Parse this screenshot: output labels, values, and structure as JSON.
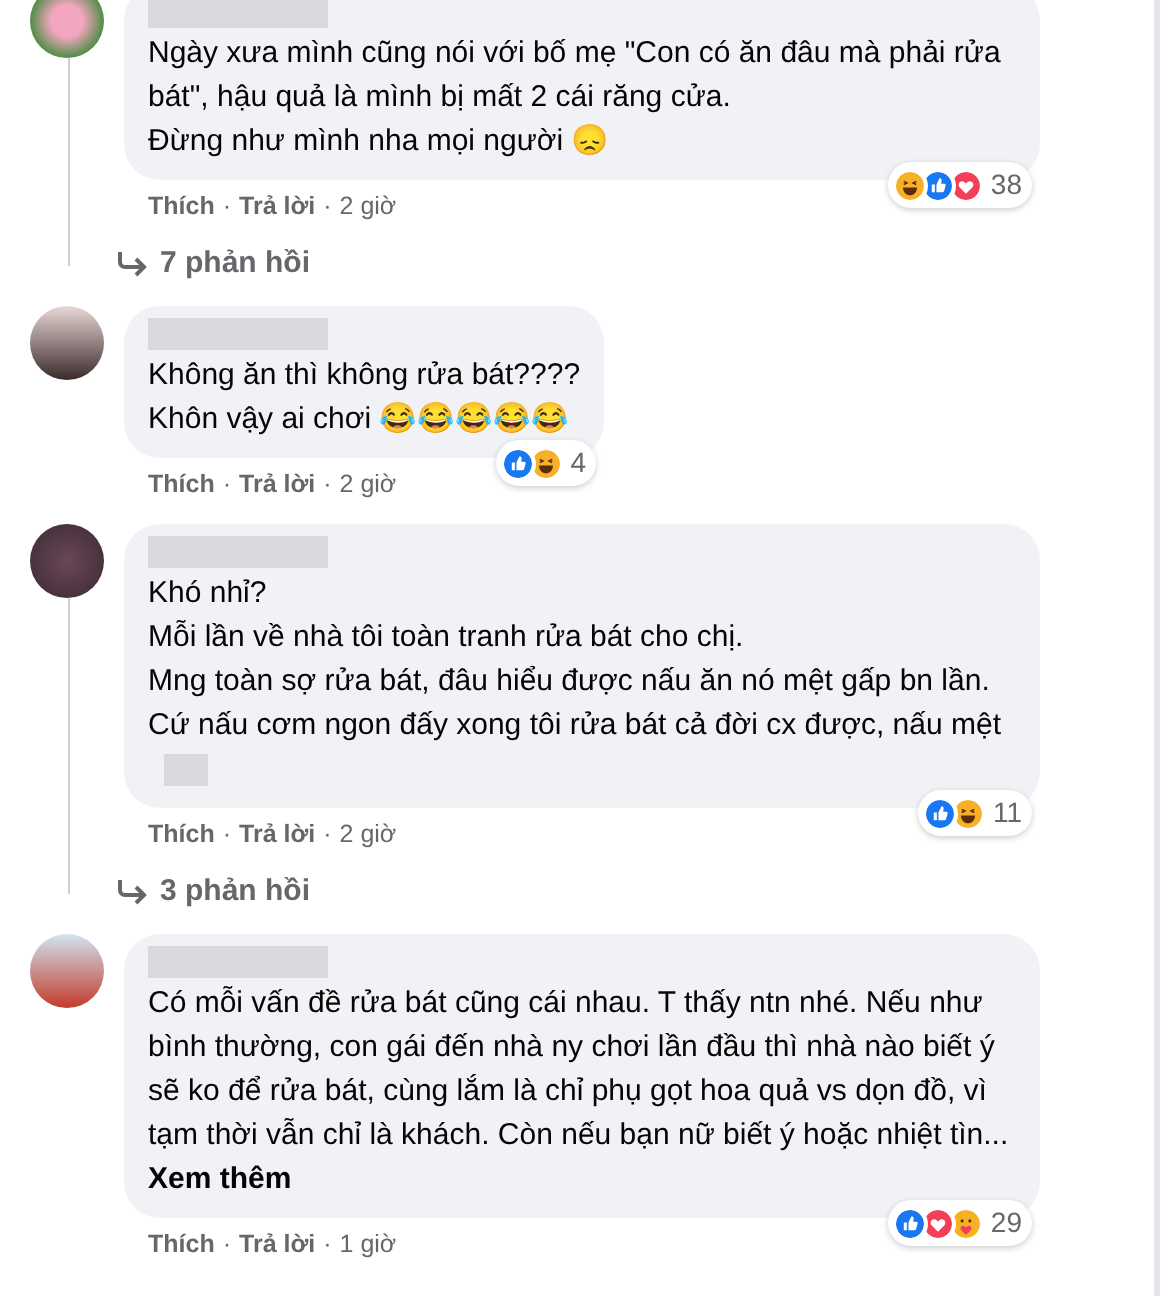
{
  "comments": [
    {
      "text": "Ngày xưa mình cũng nói với bố mẹ \"Con có ăn đâu mà phải rửa bát\", hậu quả là mình bị mất 2 cái răng cửa.\nĐừng như mình nha mọi người 😞",
      "reactions": [
        {
          "kind": "haha"
        },
        {
          "kind": "like"
        },
        {
          "kind": "love"
        }
      ],
      "reaction_count": "38",
      "like": "Thích",
      "dots": [
        "·",
        "·"
      ],
      "reply": "Trả lời",
      "time": "2 giờ",
      "replies": "7 phản hồi"
    },
    {
      "text": "Không ăn thì không rửa bát????\nKhôn vậy ai chơi 😂😂😂😂😂",
      "reactions": [
        {
          "kind": "like"
        },
        {
          "kind": "haha"
        }
      ],
      "reaction_count": "4",
      "like": "Thích",
      "dots": [
        "·",
        "·"
      ],
      "reply": "Trả lời",
      "time": "2 giờ"
    },
    {
      "text": "Khó nhỉ?\nMỗi lần về nhà tôi toàn tranh rửa bát cho chị.\nMng toàn sợ rửa bát, đâu hiểu được nấu ăn nó mệt gấp bn lần. Cứ nấu cơm ngon đấy xong tôi rửa bát cả đời cx được, nấu mệt",
      "redacted_tail": true,
      "reactions": [
        {
          "kind": "like"
        },
        {
          "kind": "haha"
        }
      ],
      "reaction_count": "11",
      "like": "Thích",
      "dots": [
        "·",
        "·"
      ],
      "reply": "Trả lời",
      "time": "2 giờ",
      "replies": "3 phản hồi"
    },
    {
      "text": "Có mỗi vấn đề rửa bát cũng cái nhau. T thấy ntn nhé. Nếu như bình thường, con gái đến nhà ny chơi lần đầu thì nhà nào biết ý sẽ ko để rửa bát, cùng lắm là chỉ phụ gọt hoa quả vs dọn đồ, vì tạm thời vẫn chỉ là khách. Còn nếu bạn nữ biết ý hoặc nhiệt tìn...",
      "see_more": "Xem thêm",
      "reactions": [
        {
          "kind": "like"
        },
        {
          "kind": "love"
        },
        {
          "kind": "care"
        }
      ],
      "reaction_count": "29",
      "like": "Thích",
      "dots": [
        "·",
        "·"
      ],
      "reply": "Trả lời",
      "time": "1 giờ"
    }
  ]
}
